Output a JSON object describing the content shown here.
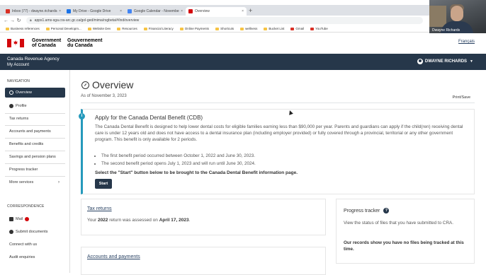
{
  "browser": {
    "tabs": [
      {
        "label": "Inbox (77) - dwayne.richards@...",
        "color": "#d93025",
        "active": false
      },
      {
        "label": "My Drive - Google Drive",
        "color": "#1a73e8",
        "active": false
      },
      {
        "label": "Google Calendar - November...",
        "color": "#4285f4",
        "active": false
      },
      {
        "label": "Overview",
        "color": "#d3080c",
        "active": true
      }
    ],
    "new_tab": "+",
    "back": "←",
    "forward": "→",
    "reload": "↻",
    "url": "apps1.ams-sga.cra-arc.gc.ca/gol-ged/mima/rsgbeta/#/ind/overview",
    "bookmarks": [
      {
        "label": "Business references",
        "color": "#f6c343"
      },
      {
        "label": "Personal Developm...",
        "color": "#f6c343"
      },
      {
        "label": "Website Dev",
        "color": "#f6c343"
      },
      {
        "label": "Resources",
        "color": "#f6c343"
      },
      {
        "label": "Financial Literacy",
        "color": "#f6c343"
      },
      {
        "label": "Online Payments",
        "color": "#f6c343"
      },
      {
        "label": "Shortcuts",
        "color": "#f6c343"
      },
      {
        "label": "wellness",
        "color": "#f6c343"
      },
      {
        "label": "Bucket List",
        "color": "#f6c343"
      },
      {
        "label": "Gmail",
        "color": "#d93025"
      },
      {
        "label": "YouTube",
        "color": "#d93025"
      }
    ]
  },
  "webcam": {
    "name": "Dwayne Richards"
  },
  "gc_header": {
    "name_en_1": "Government",
    "name_en_2": "of Canada",
    "name_fr_1": "Gouvernement",
    "name_fr_2": "du Canada",
    "language_toggle": "Français"
  },
  "cra_bar": {
    "agency": "Canada Revenue Agency",
    "my_account": "My Account",
    "user": "DWAYNE RICHARDS"
  },
  "sidebar": {
    "nav_heading": "NAVIGATION",
    "items": [
      {
        "label": "Overview",
        "active": true
      },
      {
        "label": "Profile",
        "active": false
      },
      {
        "label": "Tax returns",
        "active": false
      },
      {
        "label": "Accounts and payments",
        "active": false
      },
      {
        "label": "Benefits and credits",
        "active": false
      },
      {
        "label": "Savings and pension plans",
        "active": false
      },
      {
        "label": "Progress tracker",
        "active": false
      },
      {
        "label": "More services",
        "active": false
      }
    ],
    "corr_heading": "CORRESPONDENCE",
    "corr_items": [
      {
        "label": "Mail"
      },
      {
        "label": "Submit documents"
      },
      {
        "label": "Connect with us"
      },
      {
        "label": "Audit enquiries"
      }
    ]
  },
  "main": {
    "title": "Overview",
    "as_of": "As of November 3, 2023",
    "print_save": "Print/Save",
    "cdb": {
      "title": "Apply for the Canada Dental Benefit (CDB)",
      "paragraph": "The Canada Dental Benefit is designed to help lower dental costs for eligible families earning less than $90,000 per year. Parents and guardians can apply if the child(ren) receiving dental care is under 12 years old and does not have access to a dental insurance plan (including employer provided) or fully covered through a provincial, territorial or any other government program. This benefit is only available for 2 periods.",
      "bullets": [
        "The first benefit period occurred between October 1, 2022 and June 30, 2023.",
        "The second benefit period opens July 1, 2023 and will run until June 30, 2024."
      ],
      "cta": "Select the \"Start\" button below to be brought to the Canada Dental Benefit information page.",
      "start_button": "Start"
    },
    "tax_returns": {
      "link": "Tax returns",
      "text_before": "Your ",
      "year": "2022",
      "text_middle": " return was assessed on ",
      "date": "April 17, 2023",
      "text_after": "."
    },
    "accounts": {
      "link": "Accounts and payments"
    },
    "progress": {
      "title": "Progress tracker",
      "help": "?",
      "desc": "View the status of files that you have submitted to CRA.",
      "note": "Our records show you have no files being tracked at this time."
    }
  },
  "colors": {
    "navy": "#26374a",
    "link": "#284162",
    "info": "#269abc",
    "red": "#d3080c"
  }
}
